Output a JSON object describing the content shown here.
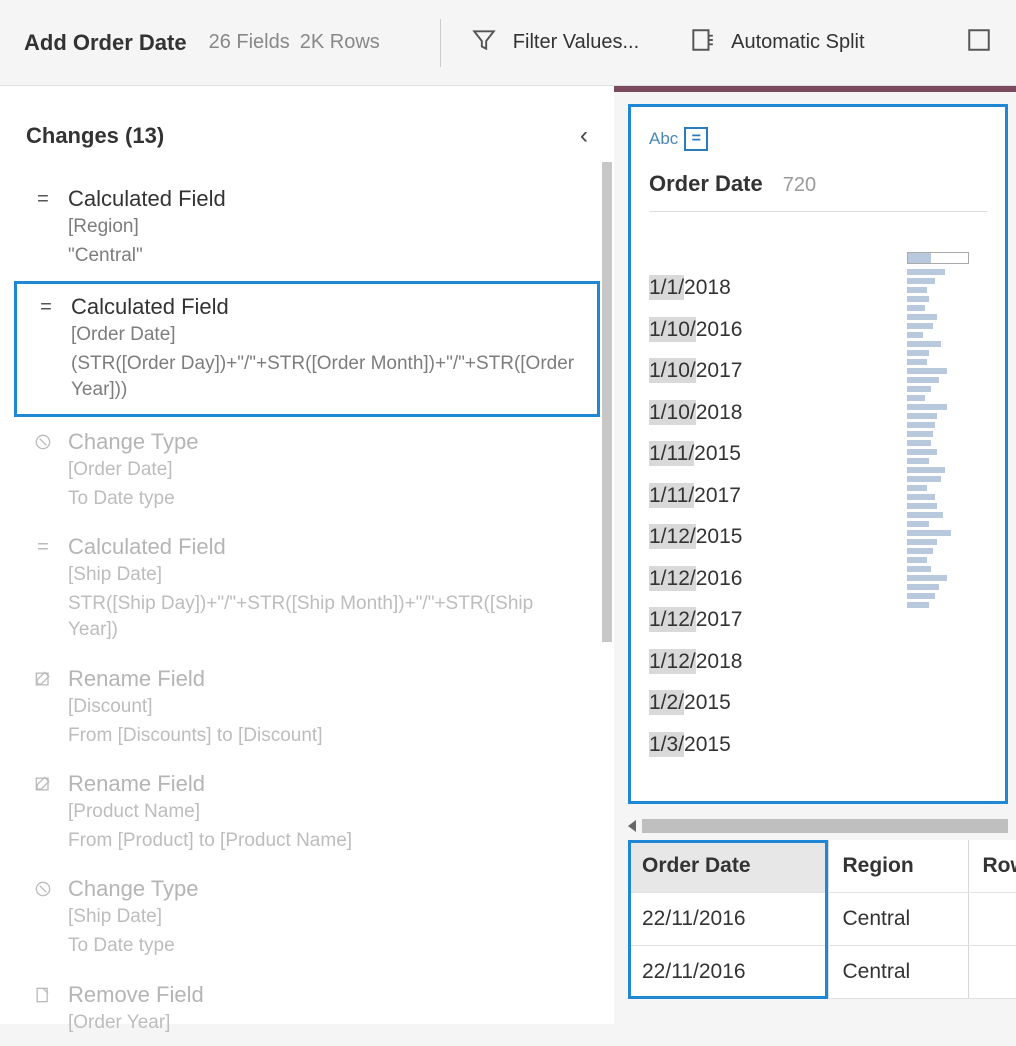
{
  "toolbar": {
    "title": "Add Order Date",
    "fields": "26 Fields",
    "rows": "2K Rows",
    "filter_label": "Filter Values...",
    "split_label": "Automatic Split"
  },
  "changes": {
    "title": "Changes (13)",
    "items": [
      {
        "label": "Calculated Field",
        "field": "[Region]",
        "detail": "\"Central\"",
        "dim": false
      },
      {
        "label": "Calculated Field",
        "field": "[Order Date]",
        "detail": "(STR([Order Day])+\"/\"+STR([Order Month])+\"/\"+STR([Order Year]))",
        "selected": true,
        "dim": false
      },
      {
        "label": "Change Type",
        "field": "[Order Date]",
        "detail": "To Date type",
        "dim": true
      },
      {
        "label": "Calculated Field",
        "field": "[Ship Date]",
        "detail": "STR([Ship Day])+\"/\"+STR([Ship Month])+\"/\"+STR([Ship Year])",
        "dim": true
      },
      {
        "label": "Rename Field",
        "field": "[Discount]",
        "detail": "From [Discounts] to [Discount]",
        "dim": true
      },
      {
        "label": "Rename Field",
        "field": "[Product Name]",
        "detail": "From [Product] to [Product Name]",
        "dim": true
      },
      {
        "label": "Change Type",
        "field": "[Ship Date]",
        "detail": "To Date type",
        "dim": true
      },
      {
        "label": "Remove Field",
        "field": "[Order Year]",
        "detail": "",
        "dim": true
      }
    ]
  },
  "profile": {
    "type_label": "Abc",
    "title": "Order Date",
    "count": "720",
    "values": [
      {
        "hl": "1/1/",
        "rest": "2018"
      },
      {
        "hl": "1/10/",
        "rest": "2016"
      },
      {
        "hl": "1/10/",
        "rest": "2017"
      },
      {
        "hl": "1/10/",
        "rest": "2018"
      },
      {
        "hl": "1/11/",
        "rest": "2015"
      },
      {
        "hl": "1/11/",
        "rest": "2017"
      },
      {
        "hl": "1/12/",
        "rest": "2015"
      },
      {
        "hl": "1/12/",
        "rest": "2016"
      },
      {
        "hl": "1/12/",
        "rest": "2017"
      },
      {
        "hl": "1/12/",
        "rest": "2018"
      },
      {
        "hl": "1/2/",
        "rest": "2015"
      },
      {
        "hl": "1/3/",
        "rest": "2015"
      }
    ],
    "histogram": [
      38,
      28,
      20,
      22,
      18,
      30,
      26,
      16,
      34,
      22,
      20,
      40,
      32,
      24,
      18,
      40,
      30,
      28,
      26,
      24,
      30,
      22,
      38,
      34,
      20,
      28,
      30,
      36,
      22,
      44,
      30,
      26,
      20,
      24,
      40,
      32,
      28,
      22
    ]
  },
  "table": {
    "columns": [
      "Order Date",
      "Region",
      "Row"
    ],
    "rows": [
      [
        "22/11/2016",
        "Central",
        ""
      ],
      [
        "22/11/2016",
        "Central",
        ""
      ]
    ]
  }
}
